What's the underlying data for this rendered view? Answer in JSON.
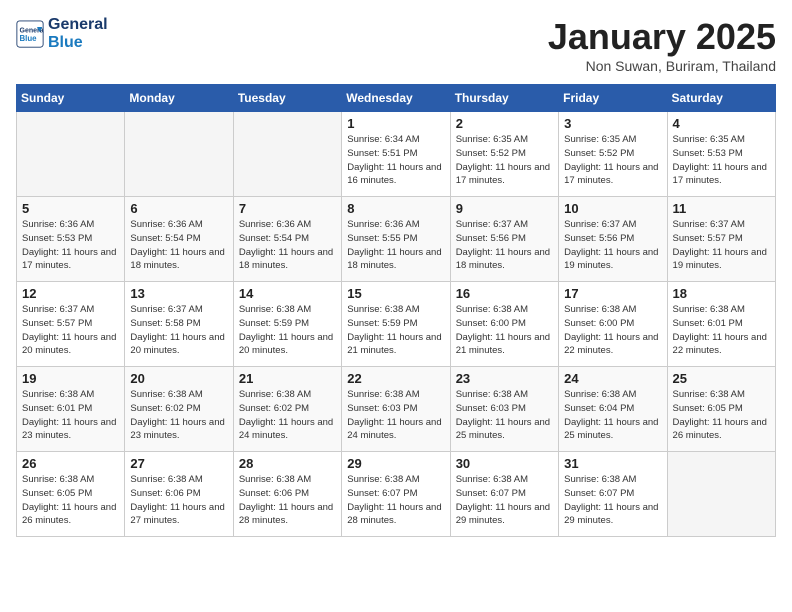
{
  "header": {
    "logo_line1": "General",
    "logo_line2": "Blue",
    "month_title": "January 2025",
    "subtitle": "Non Suwan, Buriram, Thailand"
  },
  "weekdays": [
    "Sunday",
    "Monday",
    "Tuesday",
    "Wednesday",
    "Thursday",
    "Friday",
    "Saturday"
  ],
  "weeks": [
    [
      {
        "day": "",
        "empty": true
      },
      {
        "day": "",
        "empty": true
      },
      {
        "day": "",
        "empty": true
      },
      {
        "day": "1",
        "sunrise": "6:34 AM",
        "sunset": "5:51 PM",
        "daylight": "11 hours and 16 minutes."
      },
      {
        "day": "2",
        "sunrise": "6:35 AM",
        "sunset": "5:52 PM",
        "daylight": "11 hours and 17 minutes."
      },
      {
        "day": "3",
        "sunrise": "6:35 AM",
        "sunset": "5:52 PM",
        "daylight": "11 hours and 17 minutes."
      },
      {
        "day": "4",
        "sunrise": "6:35 AM",
        "sunset": "5:53 PM",
        "daylight": "11 hours and 17 minutes."
      }
    ],
    [
      {
        "day": "5",
        "sunrise": "6:36 AM",
        "sunset": "5:53 PM",
        "daylight": "11 hours and 17 minutes."
      },
      {
        "day": "6",
        "sunrise": "6:36 AM",
        "sunset": "5:54 PM",
        "daylight": "11 hours and 18 minutes."
      },
      {
        "day": "7",
        "sunrise": "6:36 AM",
        "sunset": "5:54 PM",
        "daylight": "11 hours and 18 minutes."
      },
      {
        "day": "8",
        "sunrise": "6:36 AM",
        "sunset": "5:55 PM",
        "daylight": "11 hours and 18 minutes."
      },
      {
        "day": "9",
        "sunrise": "6:37 AM",
        "sunset": "5:56 PM",
        "daylight": "11 hours and 18 minutes."
      },
      {
        "day": "10",
        "sunrise": "6:37 AM",
        "sunset": "5:56 PM",
        "daylight": "11 hours and 19 minutes."
      },
      {
        "day": "11",
        "sunrise": "6:37 AM",
        "sunset": "5:57 PM",
        "daylight": "11 hours and 19 minutes."
      }
    ],
    [
      {
        "day": "12",
        "sunrise": "6:37 AM",
        "sunset": "5:57 PM",
        "daylight": "11 hours and 20 minutes."
      },
      {
        "day": "13",
        "sunrise": "6:37 AM",
        "sunset": "5:58 PM",
        "daylight": "11 hours and 20 minutes."
      },
      {
        "day": "14",
        "sunrise": "6:38 AM",
        "sunset": "5:59 PM",
        "daylight": "11 hours and 20 minutes."
      },
      {
        "day": "15",
        "sunrise": "6:38 AM",
        "sunset": "5:59 PM",
        "daylight": "11 hours and 21 minutes."
      },
      {
        "day": "16",
        "sunrise": "6:38 AM",
        "sunset": "6:00 PM",
        "daylight": "11 hours and 21 minutes."
      },
      {
        "day": "17",
        "sunrise": "6:38 AM",
        "sunset": "6:00 PM",
        "daylight": "11 hours and 22 minutes."
      },
      {
        "day": "18",
        "sunrise": "6:38 AM",
        "sunset": "6:01 PM",
        "daylight": "11 hours and 22 minutes."
      }
    ],
    [
      {
        "day": "19",
        "sunrise": "6:38 AM",
        "sunset": "6:01 PM",
        "daylight": "11 hours and 23 minutes."
      },
      {
        "day": "20",
        "sunrise": "6:38 AM",
        "sunset": "6:02 PM",
        "daylight": "11 hours and 23 minutes."
      },
      {
        "day": "21",
        "sunrise": "6:38 AM",
        "sunset": "6:02 PM",
        "daylight": "11 hours and 24 minutes."
      },
      {
        "day": "22",
        "sunrise": "6:38 AM",
        "sunset": "6:03 PM",
        "daylight": "11 hours and 24 minutes."
      },
      {
        "day": "23",
        "sunrise": "6:38 AM",
        "sunset": "6:03 PM",
        "daylight": "11 hours and 25 minutes."
      },
      {
        "day": "24",
        "sunrise": "6:38 AM",
        "sunset": "6:04 PM",
        "daylight": "11 hours and 25 minutes."
      },
      {
        "day": "25",
        "sunrise": "6:38 AM",
        "sunset": "6:05 PM",
        "daylight": "11 hours and 26 minutes."
      }
    ],
    [
      {
        "day": "26",
        "sunrise": "6:38 AM",
        "sunset": "6:05 PM",
        "daylight": "11 hours and 26 minutes."
      },
      {
        "day": "27",
        "sunrise": "6:38 AM",
        "sunset": "6:06 PM",
        "daylight": "11 hours and 27 minutes."
      },
      {
        "day": "28",
        "sunrise": "6:38 AM",
        "sunset": "6:06 PM",
        "daylight": "11 hours and 28 minutes."
      },
      {
        "day": "29",
        "sunrise": "6:38 AM",
        "sunset": "6:07 PM",
        "daylight": "11 hours and 28 minutes."
      },
      {
        "day": "30",
        "sunrise": "6:38 AM",
        "sunset": "6:07 PM",
        "daylight": "11 hours and 29 minutes."
      },
      {
        "day": "31",
        "sunrise": "6:38 AM",
        "sunset": "6:07 PM",
        "daylight": "11 hours and 29 minutes."
      },
      {
        "day": "",
        "empty": true
      }
    ]
  ],
  "labels": {
    "sunrise": "Sunrise:",
    "sunset": "Sunset:",
    "daylight": "Daylight:"
  }
}
